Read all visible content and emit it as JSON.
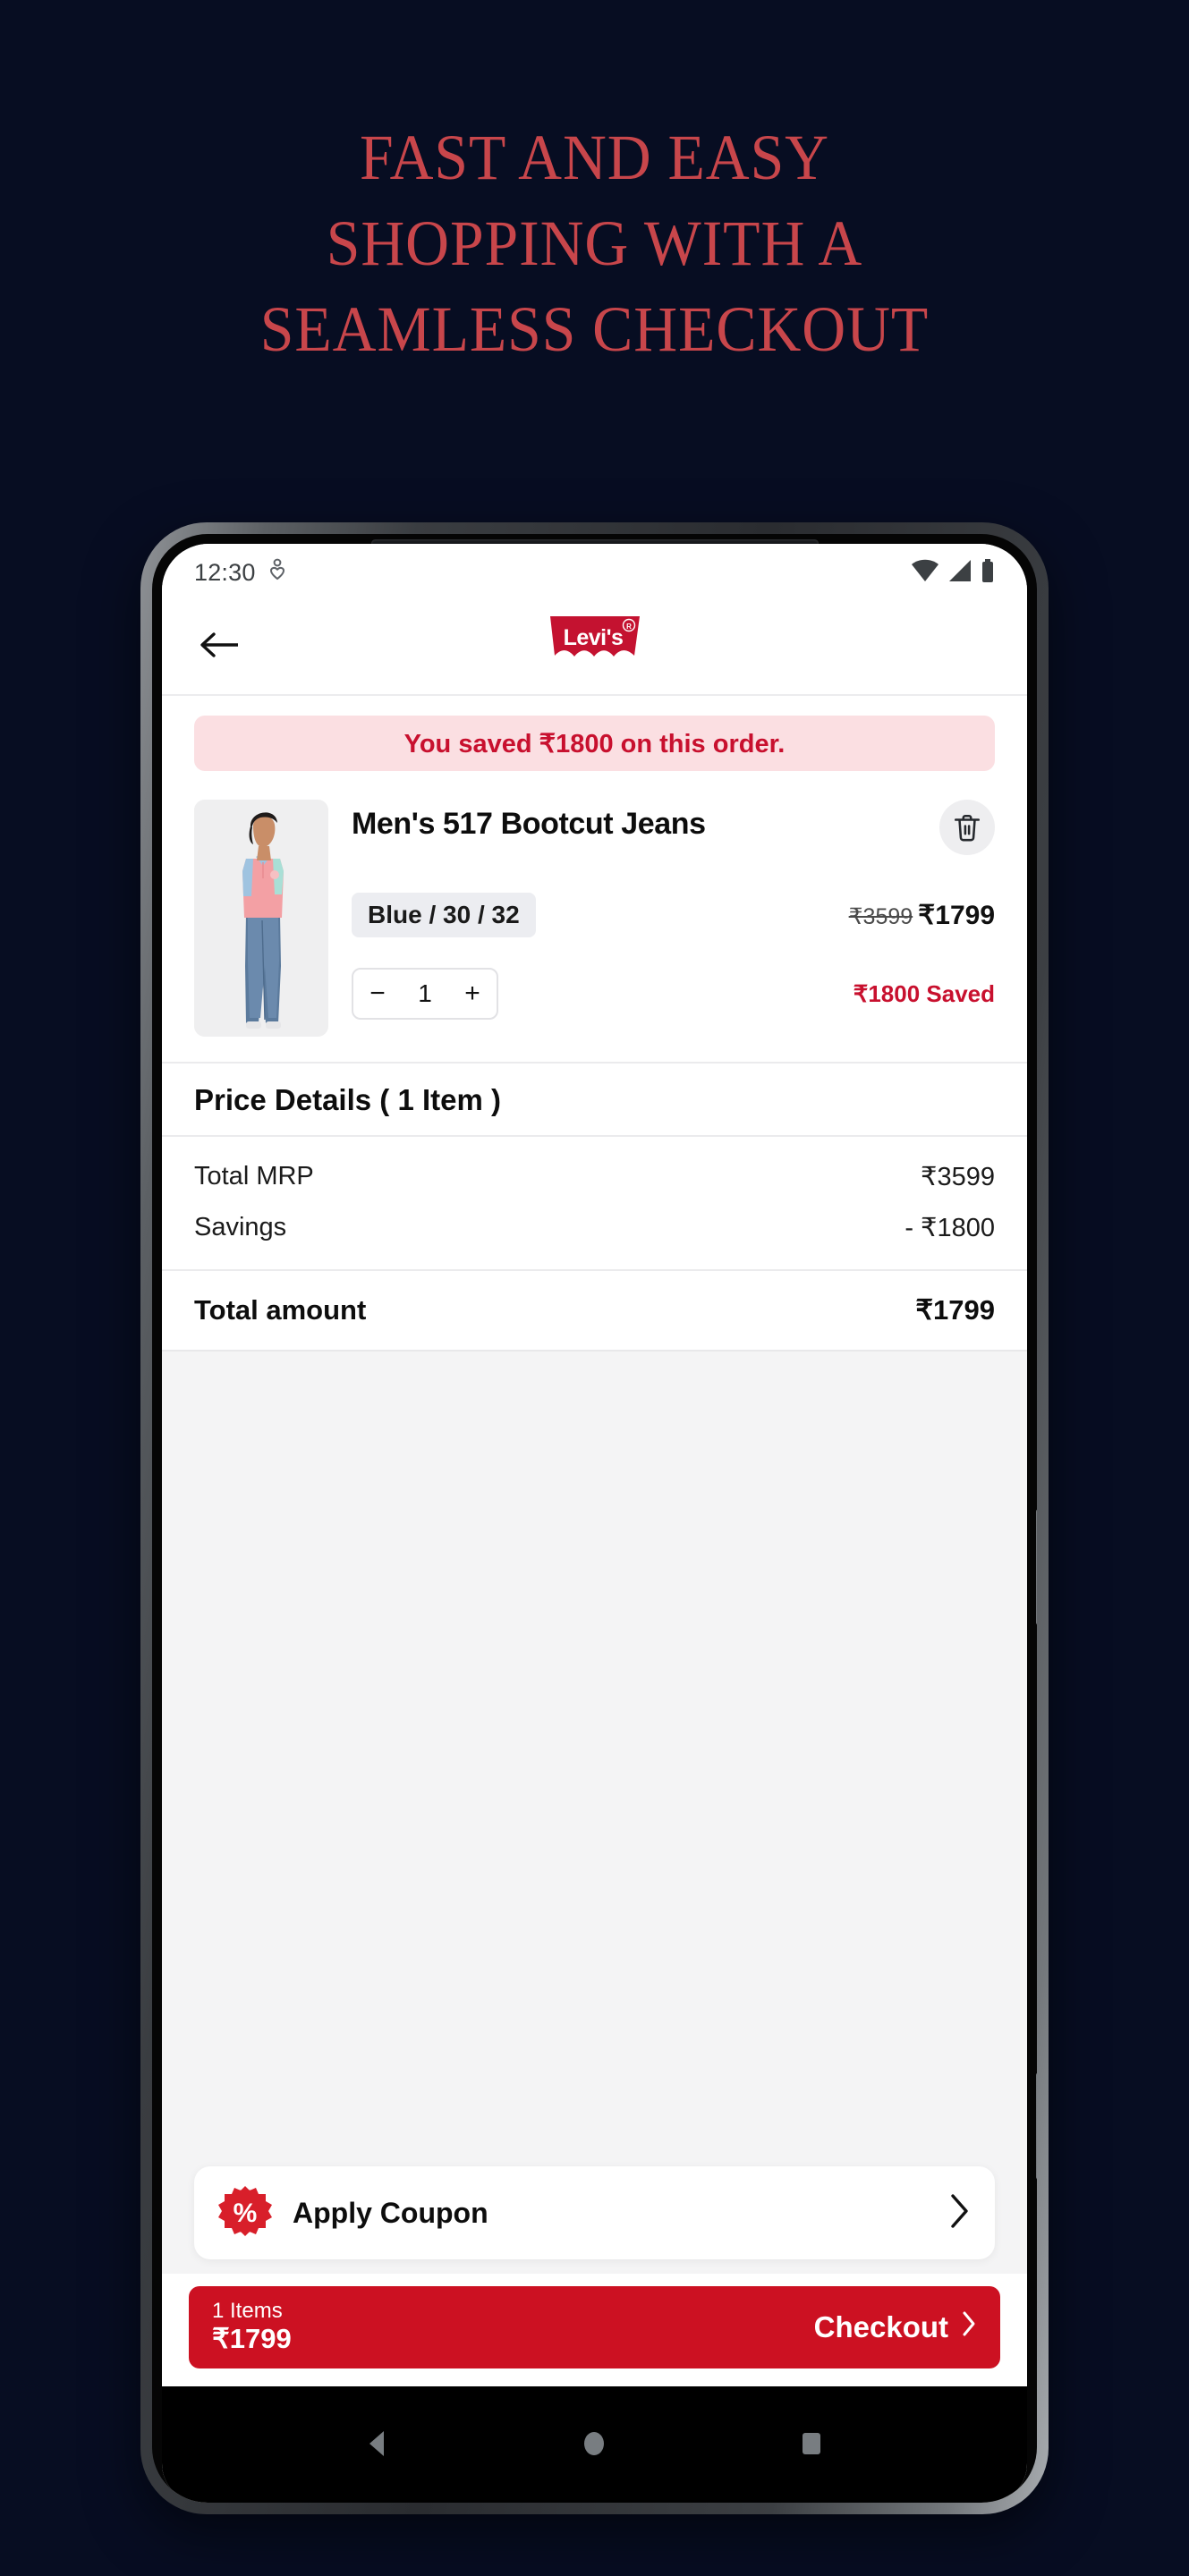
{
  "promo": {
    "headline_lines": [
      "FAST AND EASY",
      "SHOPPING WITH A",
      "SEAMLESS CHECKOUT"
    ],
    "headline_color": "#c8464b",
    "background_color": "#070d22"
  },
  "status_bar": {
    "time": "12:30",
    "icons": [
      "health-icon",
      "wifi-icon",
      "cellular-signal-icon",
      "battery-icon"
    ]
  },
  "app_bar": {
    "back_icon": "arrow-left-icon",
    "brand": "Levi's",
    "brand_trademark": "®",
    "brand_color": "#c41230"
  },
  "saved_banner": {
    "text": "You saved ₹1800 on this order.",
    "background": "#fbdfe2",
    "text_color": "#c8102e"
  },
  "cart_item": {
    "title": "Men's 517 Bootcut Jeans",
    "variant": "Blue / 30 / 32",
    "mrp": "₹3599",
    "price": "₹1799",
    "saved_tag": "₹1800 Saved",
    "quantity": "1",
    "decrement_label": "−",
    "increment_label": "+",
    "delete_icon": "trash-icon"
  },
  "price_details": {
    "heading": "Price Details ( 1 Item )",
    "rows": [
      {
        "label": "Total MRP",
        "value": "₹3599"
      },
      {
        "label": "Savings",
        "value": "- ₹1800"
      }
    ],
    "total_label": "Total amount",
    "total_value": "₹1799"
  },
  "coupon": {
    "label": "Apply Coupon",
    "badge_icon": "percent-badge-icon",
    "badge_color": "#d81f2a",
    "chevron_icon": "chevron-right-icon"
  },
  "checkout_bar": {
    "items_label": "1 Items",
    "amount": "₹1799",
    "button_label": "Checkout",
    "chevron_icon": "chevron-right-icon",
    "background": "#cc1122"
  },
  "android_nav": {
    "back_icon": "nav-back-triangle-icon",
    "home_icon": "nav-home-circle-icon",
    "recents_icon": "nav-recents-square-icon"
  }
}
